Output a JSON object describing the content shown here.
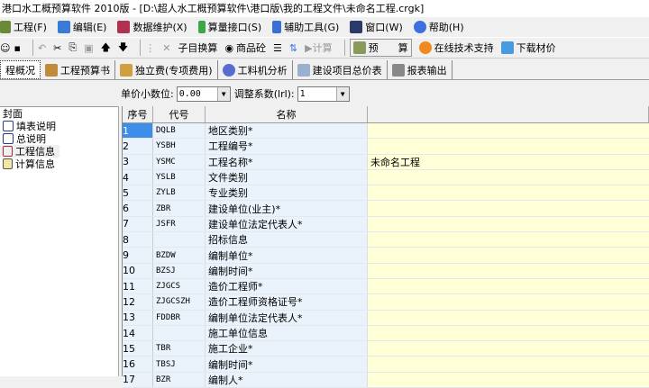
{
  "title": "港口水工概预算软件 2010版 - [D:\\超人水工概预算软件\\港口版\\我的工程文件\\未命名工程.crgk]",
  "menu": [
    "工程(F)",
    "编辑(E)",
    "数据维护(X)",
    "算量接口(S)",
    "辅助工具(G)",
    "窗口(W)",
    "帮助(H)"
  ],
  "toolbar": {
    "sub_convert": "子目换算",
    "commodity_concrete": "商品砼",
    "calc": "计算",
    "budget": "预　　算",
    "online_support": "在线技术支持",
    "download_prices": "下载材价"
  },
  "tabs": [
    "程概况",
    "工程预算书",
    "独立费(专项费用)",
    "工料机分析",
    "建设项目总价表",
    "报表输出"
  ],
  "params": {
    "decimal_label": "单价小数位:",
    "decimal_value": "0.00",
    "coef_label": "调整系数(lrl):",
    "coef_value": "1"
  },
  "tree": [
    "封面",
    "填表说明",
    "总说明",
    "工程信息",
    "计算信息"
  ],
  "grid": {
    "headers": [
      "序号",
      "代号",
      "名称",
      ""
    ],
    "rows": [
      [
        "1",
        "DQLB",
        "地区类别*",
        ""
      ],
      [
        "2",
        "YSBH",
        "工程编号*",
        ""
      ],
      [
        "3",
        "YSMC",
        "工程名称*",
        "未命名工程"
      ],
      [
        "4",
        "YSLB",
        "文件类别",
        ""
      ],
      [
        "5",
        "ZYLB",
        "专业类别",
        ""
      ],
      [
        "6",
        "ZBR",
        "建设单位(业主)*",
        ""
      ],
      [
        "7",
        "JSFR",
        "建设单位法定代表人*",
        ""
      ],
      [
        "8",
        "",
        "招标信息",
        ""
      ],
      [
        "9",
        "BZDW",
        "编制单位*",
        ""
      ],
      [
        "10",
        "BZSJ",
        "编制时间*",
        ""
      ],
      [
        "11",
        "ZJGCS",
        "造价工程师*",
        ""
      ],
      [
        "12",
        "ZJGCSZH",
        "造价工程师资格证号*",
        ""
      ],
      [
        "13",
        "FDDBR",
        "编制单位法定代表人*",
        ""
      ],
      [
        "14",
        "",
        "施工单位信息",
        ""
      ],
      [
        "15",
        "TBR",
        "施工企业*",
        ""
      ],
      [
        "16",
        "TBSJ",
        "编制时间*",
        ""
      ],
      [
        "17",
        "BZR",
        "编制人*",
        ""
      ]
    ]
  }
}
